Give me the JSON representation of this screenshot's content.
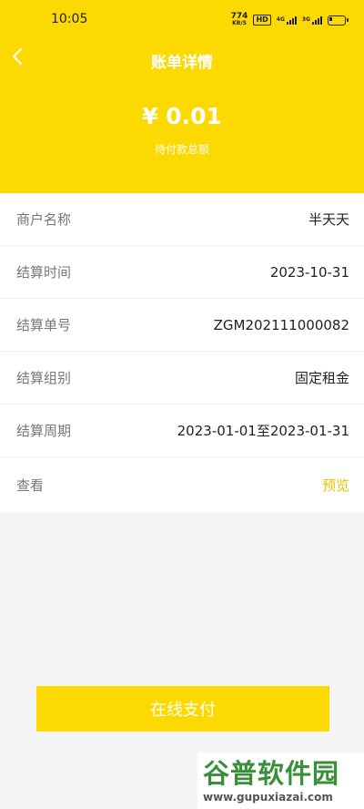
{
  "status_bar": {
    "time": "10:05",
    "net_speed": "774",
    "net_unit": "KB/S",
    "hd": "HD",
    "signal1": "4G",
    "signal2": "3G"
  },
  "nav": {
    "title": "账单详情"
  },
  "summary": {
    "amount": "¥ 0.01",
    "label": "待付款总额"
  },
  "details": [
    {
      "label": "商户名称",
      "value": "半天天"
    },
    {
      "label": "结算时间",
      "value": "2023-10-31"
    },
    {
      "label": "结算单号",
      "value": "ZGM202111000082"
    },
    {
      "label": "结算组别",
      "value": "固定租金"
    },
    {
      "label": "结算周期",
      "value": "2023-01-01至2023-01-31"
    },
    {
      "label": "查看",
      "value": "预览"
    }
  ],
  "action": {
    "pay_label": "在线支付"
  },
  "watermark": {
    "logo": "谷普软件园",
    "url": "www.gupuxiazai.com"
  },
  "colors": {
    "brand": "#fcd900",
    "link": "#e8c300"
  }
}
